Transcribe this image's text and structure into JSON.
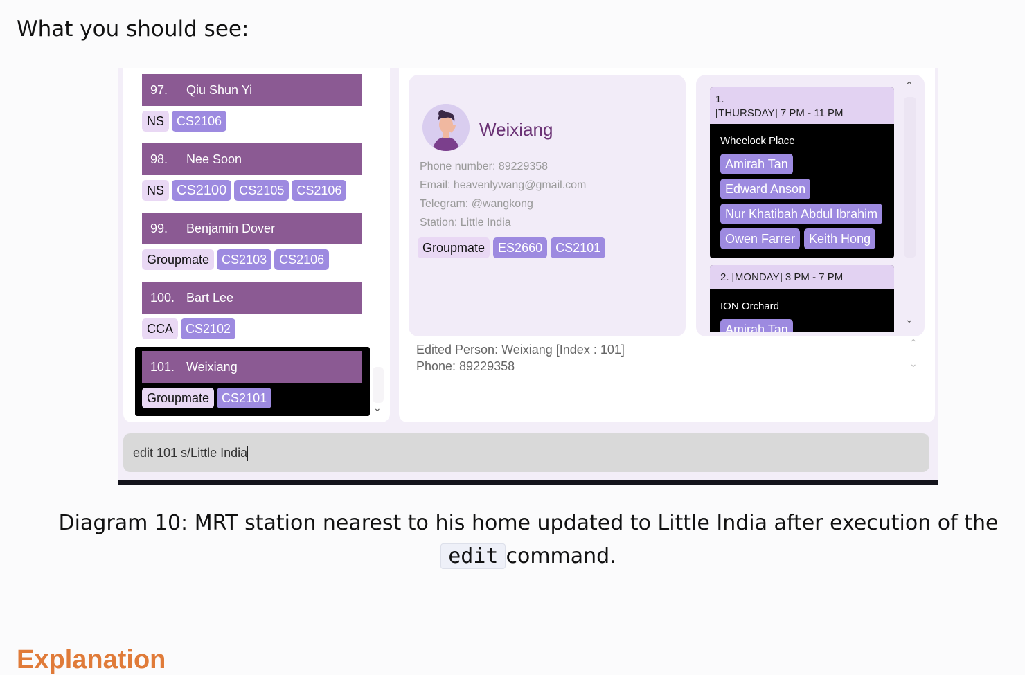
{
  "heading": "What you should see:",
  "list": {
    "cards": [
      {
        "index": "97.",
        "name": "Qiu Shun Yi",
        "tags": [
          {
            "label": "NS",
            "kind": "type"
          },
          {
            "label": "CS2106",
            "kind": "mod"
          }
        ]
      },
      {
        "index": "98.",
        "name": "Nee Soon",
        "tags": [
          {
            "label": "NS",
            "kind": "type"
          },
          {
            "label": "CS2100",
            "kind": "mod"
          },
          {
            "label": "CS2105",
            "kind": "mod"
          },
          {
            "label": "CS2106",
            "kind": "mod"
          }
        ]
      },
      {
        "index": "99.",
        "name": "Benjamin Dover",
        "tags": [
          {
            "label": "Groupmate",
            "kind": "type"
          },
          {
            "label": "CS2103",
            "kind": "mod"
          },
          {
            "label": "CS2106",
            "kind": "mod"
          }
        ]
      },
      {
        "index": "100.",
        "name": "Bart Lee",
        "tags": [
          {
            "label": "CCA",
            "kind": "type"
          },
          {
            "label": "CS2102",
            "kind": "mod"
          }
        ]
      },
      {
        "index": "101.",
        "name": "Weixiang",
        "tags": [
          {
            "label": "Groupmate",
            "kind": "type"
          },
          {
            "label": "CS2101",
            "kind": "mod"
          }
        ]
      }
    ]
  },
  "profile": {
    "name": "Weixiang",
    "phone": "Phone number: 89229358",
    "email": "Email: heavenlywang@gmail.com",
    "telegram": "Telegram: @wangkong",
    "station": "Station: Little India",
    "tags": [
      {
        "label": "Groupmate",
        "kind": "type"
      },
      {
        "label": "ES2660",
        "kind": "mod"
      },
      {
        "label": "CS2101",
        "kind": "mod"
      }
    ]
  },
  "schedule": {
    "meetings": [
      {
        "number": "1.",
        "time": "[THURSDAY] 7 PM - 11 PM",
        "location": "Wheelock Place",
        "names": [
          "Amirah Tan",
          "Edward Anson",
          "Nur Khatibah Abdul Ibrahim",
          "Owen Farrer",
          "Keith Hong"
        ]
      },
      {
        "header": "2. [MONDAY] 3 PM - 7 PM",
        "location": "ION Orchard",
        "names": [
          "Amirah Tan"
        ]
      }
    ]
  },
  "result": {
    "line1": "Edited Person: Weixiang [Index : 101]",
    "line2": "Phone: 89229358"
  },
  "command": {
    "value": "edit 101 s/Little India"
  },
  "caption": {
    "before": "Diagram 10: MRT station nearest to his home updated to Little India after execution of the",
    "code": "edit",
    "after": "command."
  },
  "next_heading": "Explanation",
  "colors": {
    "card_header": "#8b5a93",
    "type_tag": "#e9d8f4",
    "module_tag": "#9d8ae0",
    "accent_name": "#6b3275",
    "next_heading": "#e07b39"
  },
  "icons": {
    "scroll_up": "chevron-up-icon",
    "scroll_down": "chevron-down-icon",
    "avatar": "person-avatar"
  }
}
